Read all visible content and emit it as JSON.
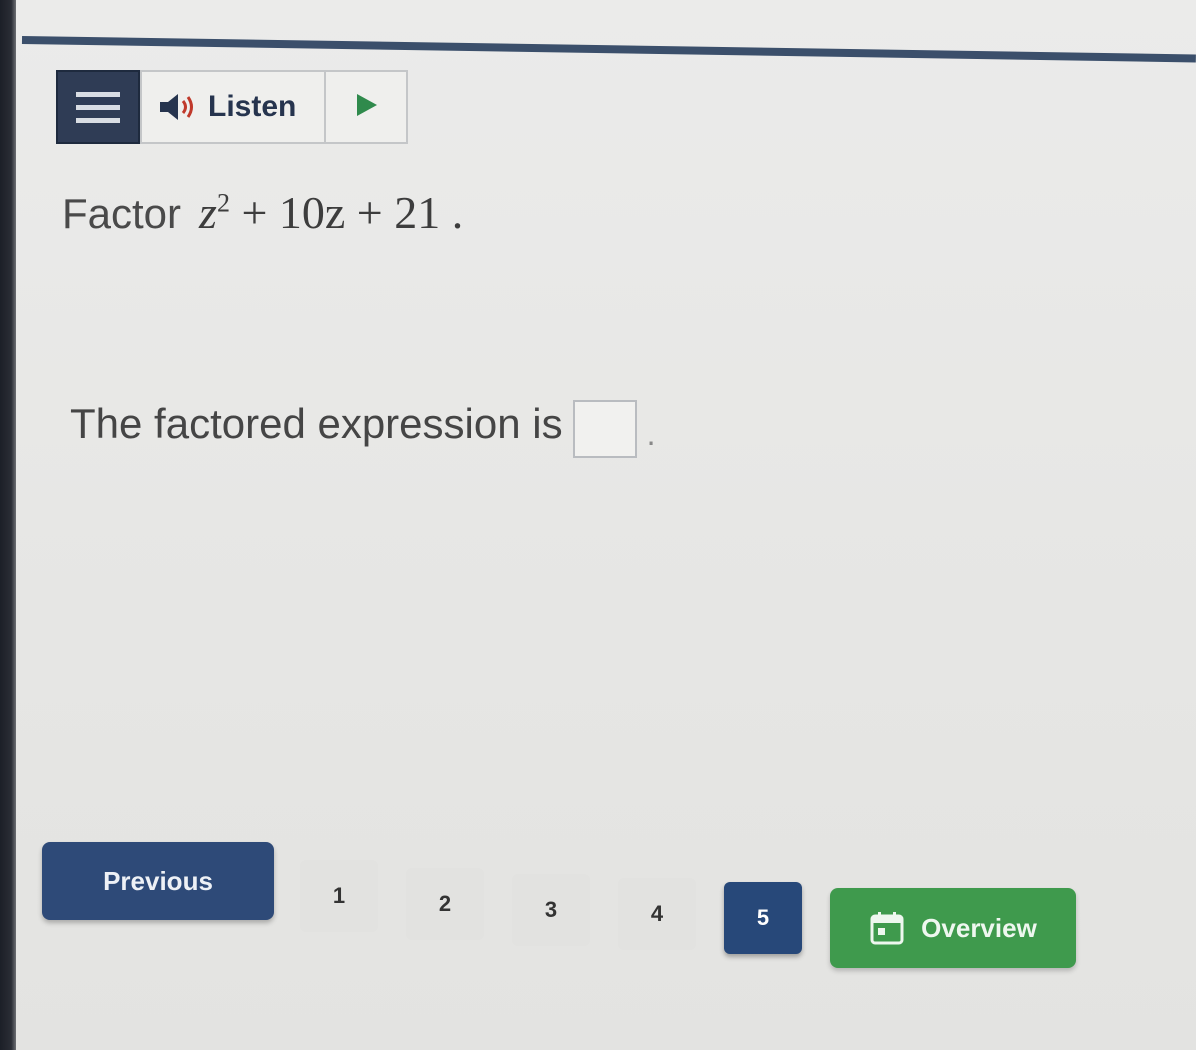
{
  "toolbar": {
    "menu_icon": "hamburger-menu-icon",
    "listen_label": "Listen",
    "speaker_icon": "speaker-icon",
    "play_icon": "play-icon"
  },
  "question": {
    "prefix": "Factor",
    "expression": {
      "var": "z",
      "exponent": "2",
      "rest": "+ 10z + 21",
      "end": "."
    }
  },
  "answer": {
    "prompt": "The factored expression is",
    "value": "",
    "suffix": "."
  },
  "nav": {
    "previous_label": "Previous",
    "pages": [
      "1",
      "2",
      "3",
      "4",
      "5"
    ],
    "active_page": "5",
    "overview_label": "Overview",
    "overview_icon": "calendar-icon"
  },
  "colors": {
    "nav_blue": "#2e4a78",
    "overview_green": "#3f9a4d",
    "play_green": "#2f8a4c"
  }
}
